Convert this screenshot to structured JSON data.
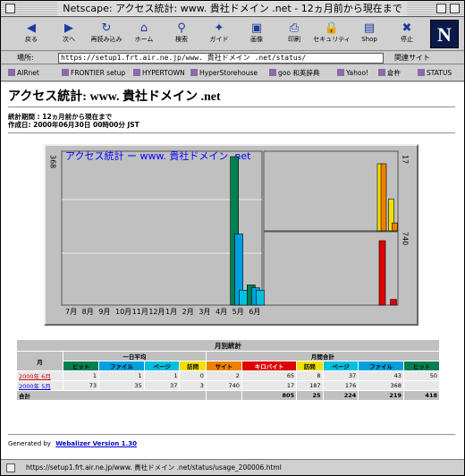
{
  "window": {
    "title": "Netscape: アクセス統計: www. 貴社ドメイン .net - 12ヵ月前から現在まで"
  },
  "toolbar": {
    "buttons": [
      {
        "label": "戻る",
        "icon": "back-icon",
        "glyph": "◀"
      },
      {
        "label": "次へ",
        "icon": "forward-icon",
        "glyph": "▶"
      },
      {
        "label": "再読み込み",
        "icon": "reload-icon",
        "glyph": "↻"
      },
      {
        "label": "ホーム",
        "icon": "home-icon",
        "glyph": "⌂"
      },
      {
        "label": "検索",
        "icon": "search-icon",
        "glyph": "⚲"
      },
      {
        "label": "ガイド",
        "icon": "guide-icon",
        "glyph": "✦"
      },
      {
        "label": "画像",
        "icon": "images-icon",
        "glyph": "▣"
      },
      {
        "label": "印刷",
        "icon": "print-icon",
        "glyph": "⎙"
      },
      {
        "label": "セキュリティ",
        "icon": "lock-icon",
        "glyph": "🔒"
      },
      {
        "label": "Shop",
        "icon": "shop-icon",
        "glyph": "▤"
      },
      {
        "label": "停止",
        "icon": "stop-icon",
        "glyph": "✖"
      }
    ],
    "logo": "N"
  },
  "location": {
    "label": "場所:",
    "url": "https://setup1.frt.air.ne.jp/www. 貴社ドメイン .net/status/",
    "related": "関連サイト"
  },
  "personal": [
    "AIRnet",
    "FRONTIER setup",
    "HYPERTOWN",
    "HyperStorehouse",
    "goo 和英辞典",
    "Yahoo!",
    "倉杵",
    "STATUS"
  ],
  "page": {
    "title": "アクセス統計: www. 貴社ドメイン .net",
    "period": "統計期間 : 12ヵ月前から現在まで",
    "created": "作成日: 2000年06月30日 00時00分 JST",
    "footer_prefix": "Generated by",
    "footer_link": "Webalizer Version 1.30"
  },
  "chart_data": {
    "type": "bar",
    "title": "アクセス統計 ー www. 貴社ドメイン .net",
    "left_axis_label": "368",
    "right_axis_top": "17",
    "right_axis_mid": "740",
    "categories": [
      "7月",
      "8月",
      "9月",
      "10月",
      "11月",
      "12月",
      "1月",
      "2月",
      "3月",
      "4月",
      "5月",
      "6月"
    ],
    "hits": [
      0,
      0,
      0,
      0,
      0,
      0,
      0,
      0,
      0,
      0,
      368,
      50
    ],
    "files": [
      0,
      0,
      0,
      0,
      0,
      0,
      0,
      0,
      0,
      0,
      176,
      43
    ],
    "pages": [
      0,
      0,
      0,
      0,
      0,
      0,
      0,
      0,
      0,
      0,
      37,
      37
    ],
    "visits": [
      0,
      0,
      0,
      0,
      0,
      0,
      0,
      0,
      0,
      0,
      17,
      8
    ],
    "sites": [
      0,
      0,
      0,
      0,
      0,
      0,
      0,
      0,
      0,
      0,
      17,
      2
    ],
    "kbytes": [
      0,
      0,
      0,
      0,
      0,
      0,
      0,
      0,
      0,
      0,
      740,
      65
    ],
    "colors": {
      "hits": "#00804f",
      "files": "#00a0e0",
      "pages": "#00c0e0",
      "visits": "#f0e000",
      "sites": "#f08000",
      "kbytes": "#e00000"
    }
  },
  "stats": {
    "title": "月別統計",
    "month_header": "月",
    "daily_avg": "一日平均",
    "monthly_total": "月間合計",
    "daily_cols": [
      "ヒット",
      "ファイル",
      "ページ",
      "訪問"
    ],
    "total_cols": [
      "サイト",
      "キロバイト",
      "訪問",
      "ページ",
      "ファイル",
      "ヒット"
    ],
    "rows": [
      {
        "month": "2000年 6月",
        "daily": [
          "1",
          "1",
          "1",
          "0"
        ],
        "total": [
          "2",
          "65",
          "8",
          "37",
          "43",
          "50"
        ]
      },
      {
        "month": "2000年 5月",
        "daily": [
          "73",
          "35",
          "37",
          "3"
        ],
        "total": [
          "740",
          "17",
          "187",
          "176",
          "368",
          ""
        ]
      }
    ],
    "total_label": "合計",
    "total_values": [
      "805",
      "25",
      "224",
      "219",
      "418"
    ]
  },
  "status": {
    "text": "https://setup1.frt.air.ne.jp/www. 貴社ドメイン .net/status/usage_200006.html"
  }
}
